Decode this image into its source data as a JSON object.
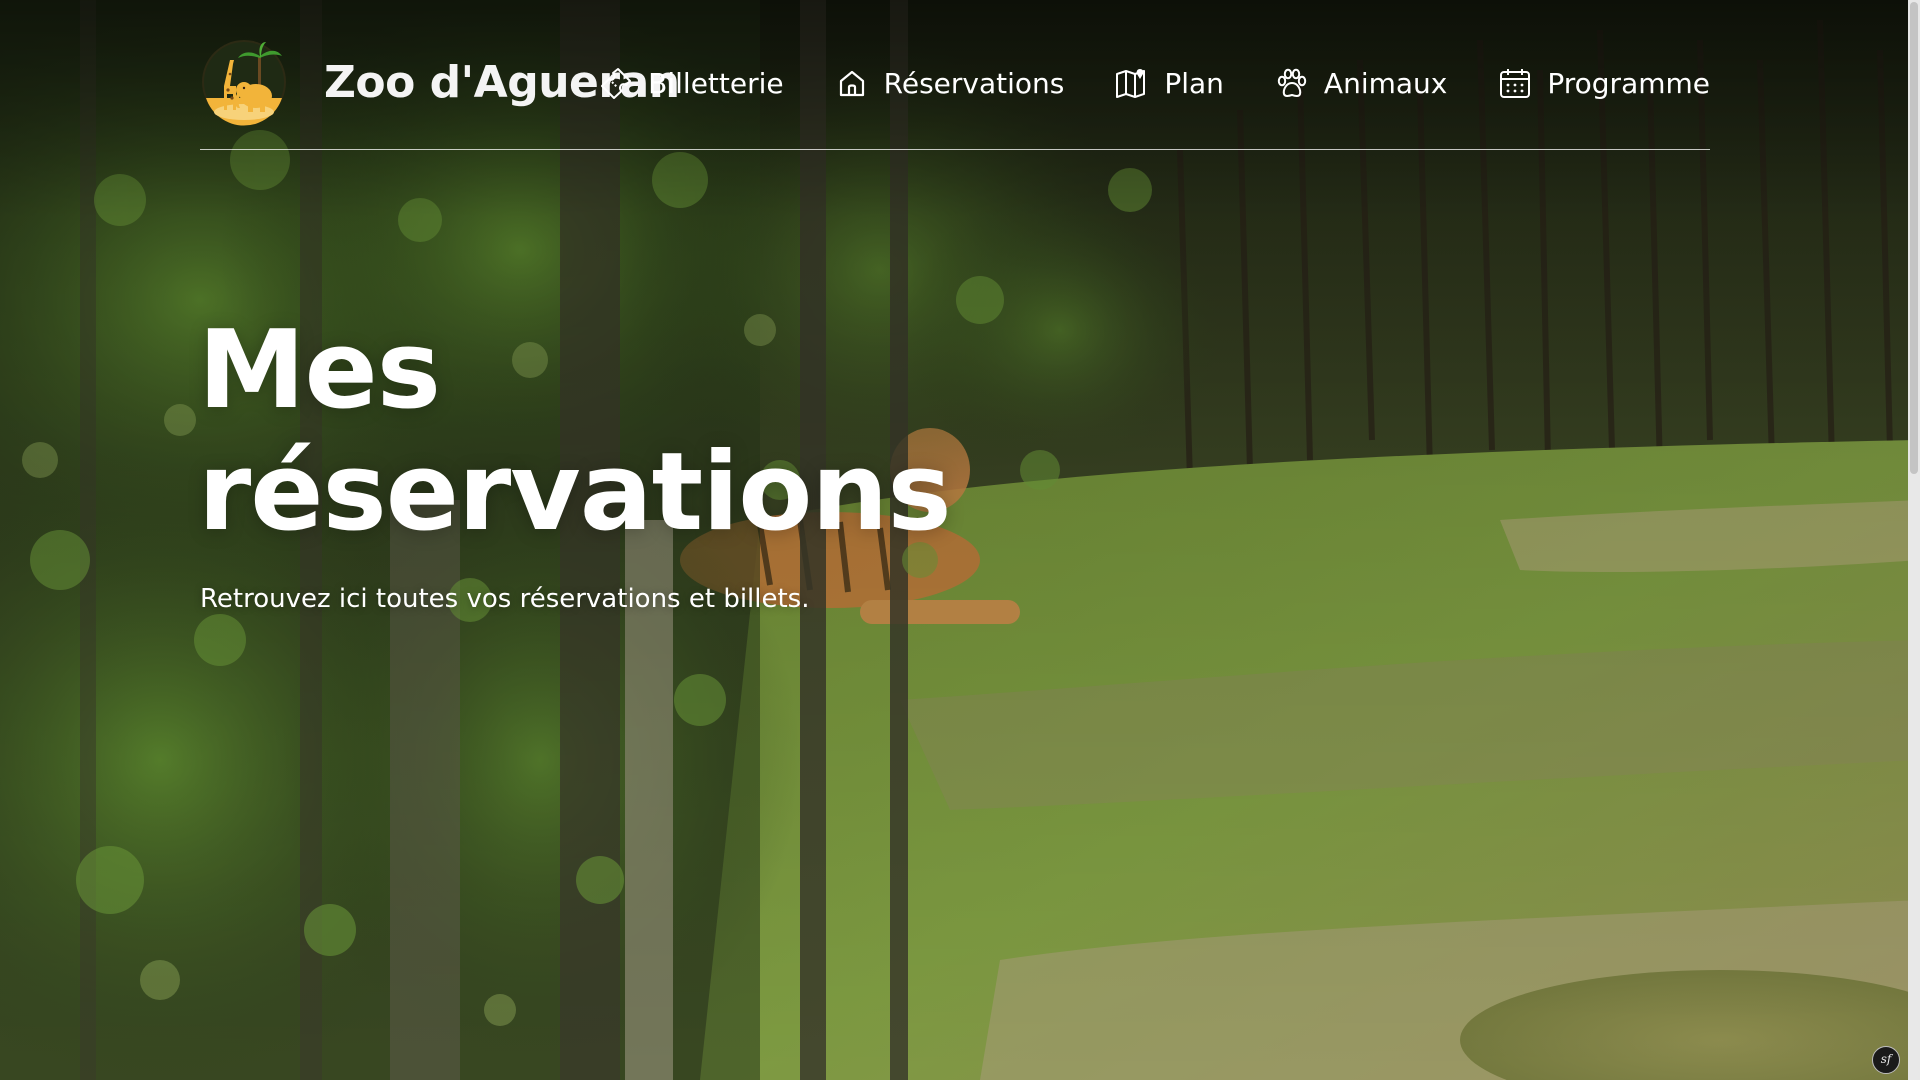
{
  "brand": {
    "name": "Zoo d'Agueran",
    "logo_icon": "giraffe-elephant-palm-logo"
  },
  "nav": {
    "items": [
      {
        "label": "Billetterie",
        "icon": "ticket-icon"
      },
      {
        "label": "Réservations",
        "icon": "home-icon"
      },
      {
        "label": "Plan",
        "icon": "map-icon"
      },
      {
        "label": "Animaux",
        "icon": "paw-icon"
      },
      {
        "label": "Programme",
        "icon": "calendar-icon"
      }
    ]
  },
  "hero": {
    "title_line1": "Mes",
    "title_line2": "réservations",
    "subtitle": "Retrouvez ici toutes vos réservations et billets."
  },
  "badge": {
    "label": "sf"
  },
  "colors": {
    "text": "#ffffff",
    "divider": "#ffffff",
    "logo_gold": "#f2b43a",
    "logo_palm": "#3f9a2e",
    "foliage_dark": "#243217",
    "grass": "#7a9a3c"
  }
}
